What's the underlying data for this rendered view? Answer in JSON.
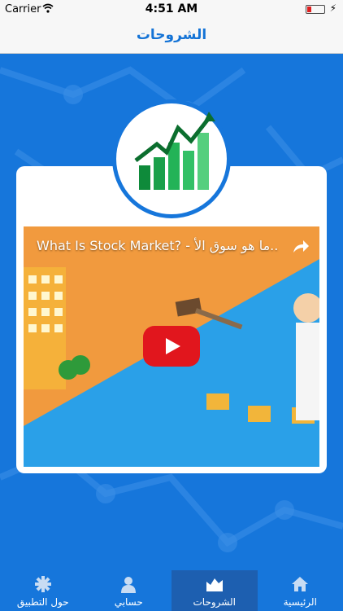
{
  "status": {
    "carrier": "Carrier",
    "time": "4:51 AM"
  },
  "header": {
    "title": "الشروحات"
  },
  "video": {
    "title": "What Is Stock Market? - ما هو سوق الأ.."
  },
  "tabs": [
    {
      "label": "حول التطبيق",
      "icon": "info-icon"
    },
    {
      "label": "حسابي",
      "icon": "user-icon"
    },
    {
      "label": "الشروحات",
      "icon": "chart-icon"
    },
    {
      "label": "الرئيسية",
      "icon": "home-icon"
    }
  ],
  "colors": {
    "accent": "#1473d6",
    "tab_active": "#1d5fb0",
    "youtube": "#e1161d"
  }
}
